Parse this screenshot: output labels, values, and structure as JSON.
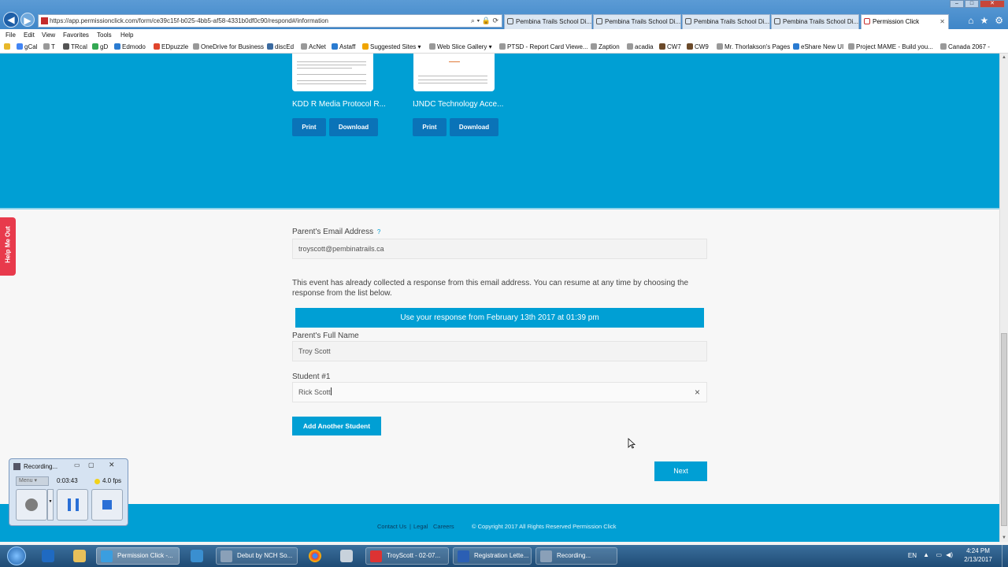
{
  "browser": {
    "url": "https://app.permissionclick.com/form/ce39c15f-b025-4bb5-af58-4331b0df0c90/respond#/information",
    "tabs": [
      {
        "label": "Pembina Trails School Di..."
      },
      {
        "label": "Pembina Trails School Di..."
      },
      {
        "label": "Pembina Trails School Di..."
      },
      {
        "label": "Pembina Trails School Di..."
      },
      {
        "label": "Permission Click",
        "active": true
      }
    ],
    "menu": [
      "File",
      "Edit",
      "View",
      "Favorites",
      "Tools",
      "Help"
    ],
    "favorites": [
      "gCal",
      "T",
      "TRcal",
      "gD",
      "Edmodo",
      "EDpuzzle",
      "OneDrive for Business",
      "discEd",
      "AcNet",
      "Astaff",
      "Suggested Sites ▾",
      "Web Slice Gallery ▾",
      "PTSD - Report Card Viewe...",
      "Zaption",
      "acadia",
      "CW7",
      "CW9",
      "Mr. Thorlakson's Pages",
      "eShare New UI",
      "Project MAME - Build you...",
      "Canada 2067 -"
    ]
  },
  "documents": [
    {
      "title": "KDD R Media Protocol R...",
      "print_label": "Print",
      "download_label": "Download"
    },
    {
      "title": "IJNDC Technology Acce...",
      "print_label": "Print",
      "download_label": "Download"
    }
  ],
  "form": {
    "email_label": "Parent's Email Address",
    "email_help": "?",
    "email_value": "troyscott@pembinatrails.ca",
    "info_text": "This event has already collected a response from this email address. You can resume at any time by choosing the response from the list below.",
    "resume_label": "Use your response from February 13th 2017 at 01:39 pm",
    "fullname_label": "Parent's Full Name",
    "fullname_value": "Troy Scott",
    "student_label": "Student #1",
    "student_value": "Rick Scott",
    "clear_symbol": "×",
    "add_student_label": "Add Another Student",
    "next_label": "Next"
  },
  "help_tab": "Help Me Out",
  "footer": {
    "contact": "Contact Us",
    "sep": "|",
    "legal": "Legal",
    "careers": "Careers",
    "copyright": "© Copyright 2017 All Rights Reserved Permission Click"
  },
  "recorder": {
    "title": "Recording...",
    "mode": "Menu ▾",
    "time": "0:03:43",
    "fps": "4.0 fps"
  },
  "taskbar": {
    "items": [
      "Permission Click -...",
      "Debut by NCH So...",
      "TroyScott - 02-07...",
      "Registration Lette...",
      "Recording..."
    ],
    "lang": "EN",
    "time": "4:24 PM",
    "date": "2/13/2017"
  },
  "colors": {
    "primary": "#009fd4",
    "button_dark": "#0a73b8",
    "help": "#e83a4c"
  }
}
